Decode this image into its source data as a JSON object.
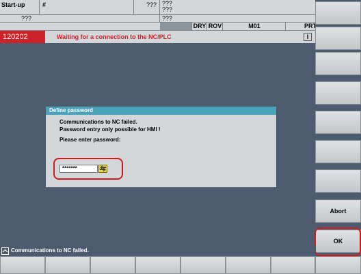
{
  "header": {
    "mode_label": "Start-up",
    "channel_symbol": "#",
    "field_a": "???",
    "program_line1": "???",
    "program_line2": "???",
    "sub_left": "???",
    "sub_right": "???",
    "status_tags": [
      "DRY",
      "ROV",
      "M01",
      "PRT"
    ]
  },
  "alarm": {
    "number": "120202",
    "text": "Waiting for a connection to the NC/PLC",
    "ack_symbol": "I"
  },
  "dialog": {
    "title": "Define password",
    "line1": "Communications to NC failed.",
    "line2": "Password entry only possible for HMI !",
    "prompt": "Please enter password:",
    "password_value": "*******"
  },
  "status_bar": {
    "message": "Communications to NC failed."
  },
  "softkeys": {
    "abort_label": "Abort",
    "ok_label": "OK"
  },
  "colors": {
    "background": "#4d5b6e",
    "dialog_title": "#4aa3b8",
    "alarm_bg": "#cc2229",
    "highlight": "#d11b1b"
  }
}
